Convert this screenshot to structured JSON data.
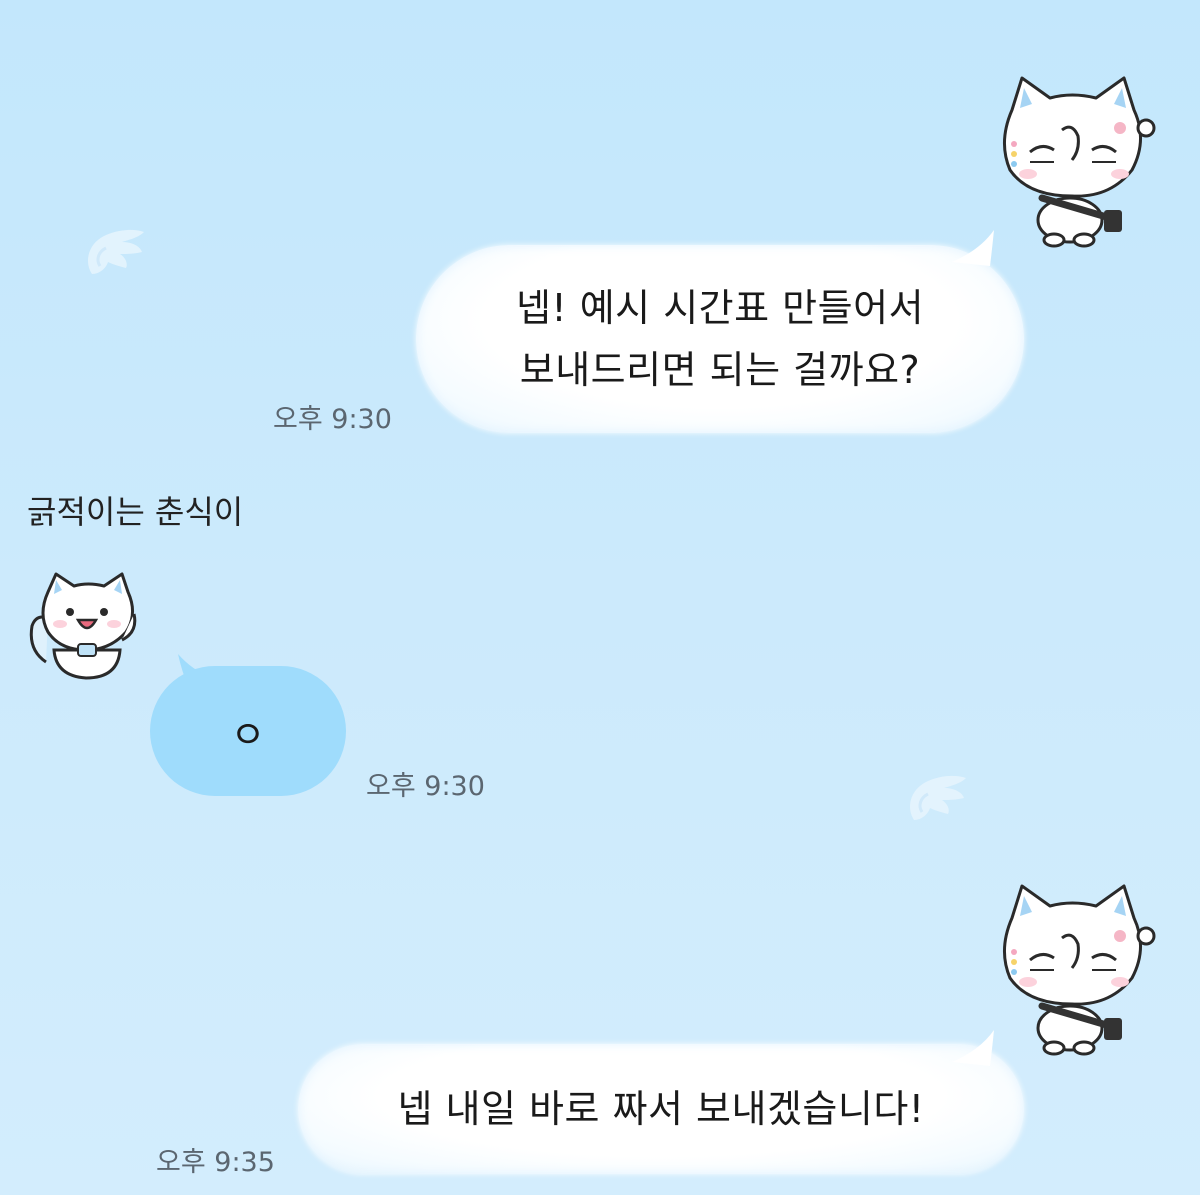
{
  "chat": {
    "messages": [
      {
        "direction": "outgoing",
        "text": "넵! 예시 시간표 만들어서\n보내드리면 되는 걸까요?",
        "time": "오후 9:30"
      },
      {
        "direction": "incoming",
        "sender": "긁적이는 춘식이",
        "text": "ㅇ",
        "time": "오후 9:30"
      },
      {
        "direction": "outgoing",
        "text": "넵 내일 바로 짜서 보내겠습니다!",
        "time": "오후 9:35"
      }
    ]
  },
  "colors": {
    "background_top": "#c3e7fc",
    "background_bottom": "#d3edfd",
    "outgoing_bubble": "#ffffff",
    "incoming_bubble": "#9fdcfc",
    "timestamp_text": "#5b6670"
  },
  "icons": {
    "self_avatar": "white-cat-with-bag-sticker",
    "sender_avatar": "white-cat-waving-sticker",
    "decoration": "wing-icon"
  }
}
